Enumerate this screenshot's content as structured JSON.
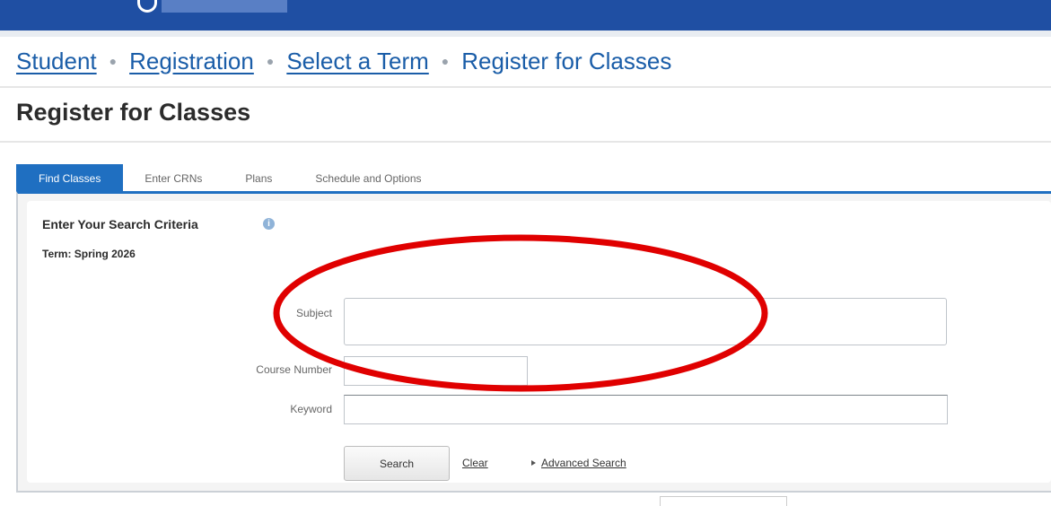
{
  "breadcrumb": {
    "items": [
      {
        "label": "Student"
      },
      {
        "label": "Registration"
      },
      {
        "label": "Select a Term"
      },
      {
        "label": "Register for Classes"
      }
    ]
  },
  "page": {
    "title": "Register for Classes"
  },
  "tabs": [
    {
      "label": "Find Classes",
      "active": true
    },
    {
      "label": "Enter CRNs"
    },
    {
      "label": "Plans"
    },
    {
      "label": "Schedule and Options"
    }
  ],
  "search": {
    "title": "Enter Your Search Criteria",
    "term": "Term: Spring 2026",
    "fields": {
      "subject": {
        "label": "Subject",
        "value": ""
      },
      "course_number": {
        "label": "Course Number",
        "value": ""
      },
      "keyword": {
        "label": "Keyword",
        "value": ""
      }
    },
    "buttons": {
      "search": "Search",
      "clear": "Clear",
      "advanced": "Advanced Search"
    }
  },
  "colors": {
    "header": "#1f4fa3",
    "accent": "#1f6fc1",
    "link": "#1a5da8",
    "annotation": "#e00000"
  },
  "icons": {
    "info": "info-icon",
    "caret": "caret-right-icon"
  }
}
